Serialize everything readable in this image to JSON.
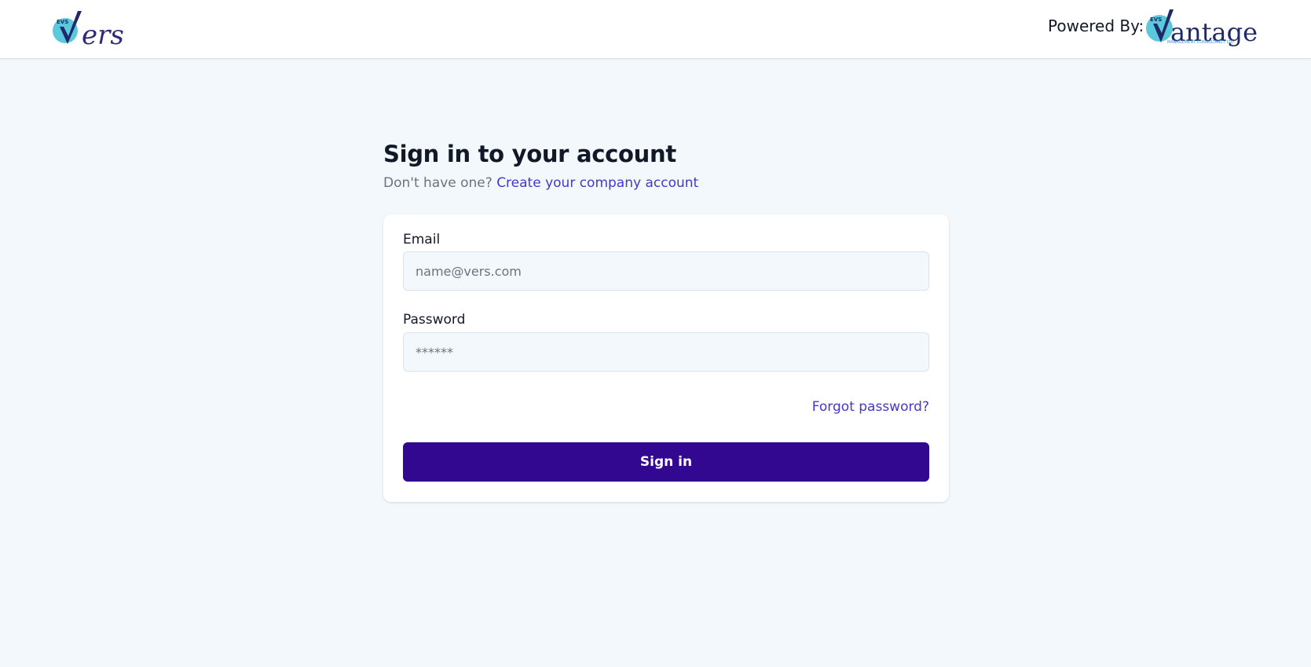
{
  "header": {
    "logo_text": "vers",
    "logo_mark": "EVS",
    "powered_by": "Powered By:",
    "partner_logo_text": "Vantage",
    "partner_logo_tagline": "MANAGEMENT CONSULTANCY LTD"
  },
  "signin": {
    "title": "Sign in to your account",
    "subtitle_prefix": "Don't have one?",
    "create_account_link": "Create your company account",
    "email_label": "Email",
    "email_placeholder": "name@vers.com",
    "password_label": "Password",
    "password_placeholder": "******",
    "forgot_password": "Forgot password?",
    "submit_label": "Sign in"
  },
  "colors": {
    "background": "#f3f8fc",
    "primary_button": "#330890",
    "link": "#4338ca",
    "logo_circle": "#5bc8dc",
    "logo_text": "#2d2a7a"
  }
}
